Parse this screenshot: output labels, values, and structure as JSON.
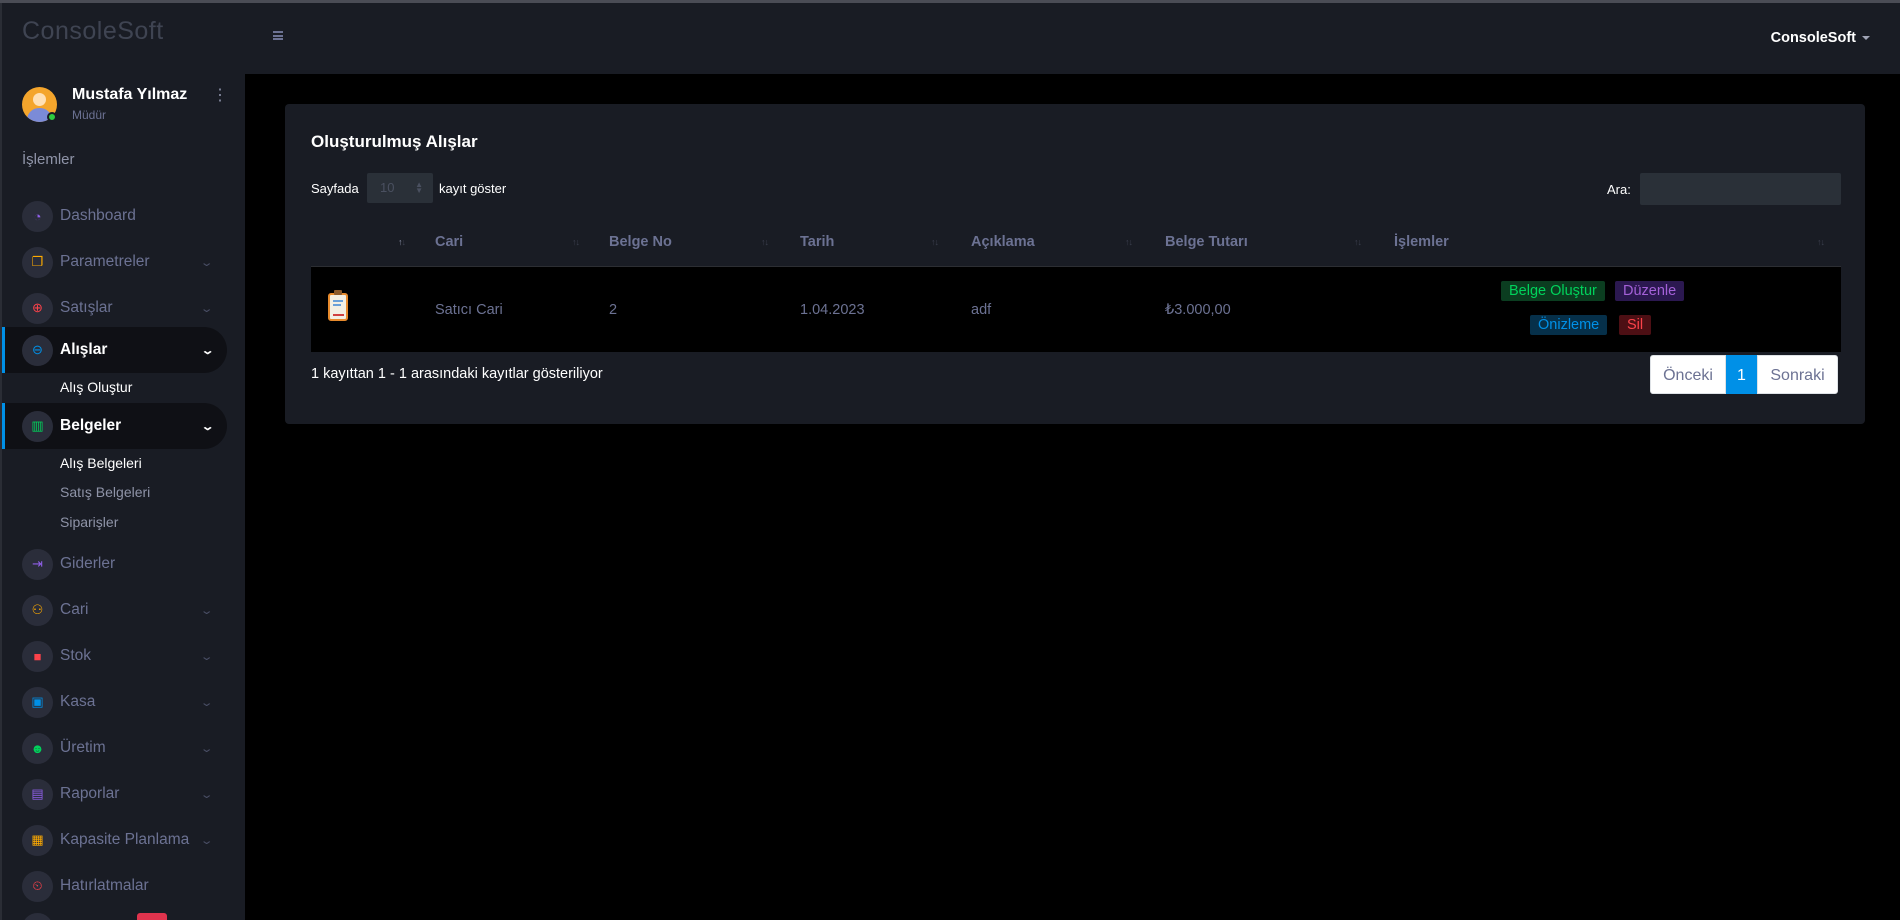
{
  "app": {
    "brand": "ConsoleSoft"
  },
  "user": {
    "name": "Mustafa Yılmaz",
    "role": "Müdür",
    "menu_label": "ConsoleSoft"
  },
  "sidebar": {
    "section": "İşlemler",
    "items": [
      {
        "label": "Dashboard",
        "icon": "speedometer-icon",
        "color": "#8f5fe8"
      },
      {
        "label": "Parametreler",
        "icon": "layers-icon",
        "color": "#ffab00"
      },
      {
        "label": "Satışlar",
        "icon": "plus-circle-icon",
        "color": "#fc424a"
      },
      {
        "label": "Alışlar",
        "icon": "minus-circle-icon",
        "color": "#0090e7"
      },
      {
        "label": "Belgeler",
        "icon": "book-icon",
        "color": "#00d25b"
      },
      {
        "label": "Giderler",
        "icon": "arrow-right-icon",
        "color": "#8f5fe8"
      },
      {
        "label": "Cari",
        "icon": "users-icon",
        "color": "#ffab00"
      },
      {
        "label": "Stok",
        "icon": "box-icon",
        "color": "#fc424a"
      },
      {
        "label": "Kasa",
        "icon": "cash-icon",
        "color": "#0090e7"
      },
      {
        "label": "Üretim",
        "icon": "robot-icon",
        "color": "#00d25b"
      },
      {
        "label": "Raporlar",
        "icon": "clipboard-icon",
        "color": "#8f5fe8"
      },
      {
        "label": "Kapasite Planlama",
        "icon": "clipboard-check-icon",
        "color": "#ffab00"
      },
      {
        "label": "Hatırlatmalar",
        "icon": "alarm-icon",
        "color": "#fc424a"
      }
    ],
    "alislar_sub": [
      "Alış Oluştur"
    ],
    "belgeler_sub": [
      "Alış Belgeleri",
      "Satış Belgeleri",
      "Siparişler"
    ]
  },
  "card": {
    "title": "Oluşturulmuş Alışlar",
    "length_prefix": "Sayfada",
    "length_value": "10",
    "length_suffix": "kayıt göster",
    "search_label": "Ara:",
    "search_value": "",
    "columns": [
      "",
      "Cari",
      "Belge No",
      "Tarih",
      "Açıklama",
      "Belge Tutarı",
      "İşlemler"
    ],
    "rows": [
      {
        "icon": "clipboard-chart-icon",
        "cari": "Satıcı Cari",
        "belge_no": "2",
        "tarih": "1.04.2023",
        "aciklama": "adf",
        "tutar": "₺3.000,00",
        "actions": {
          "create": "Belge Oluştur",
          "edit": "Düzenle",
          "preview": "Önizleme",
          "delete": "Sil"
        }
      }
    ],
    "info": "1 kayıttan 1 - 1 arasındaki kayıtlar gösteriliyor",
    "pager": {
      "prev": "Önceki",
      "current": "1",
      "next": "Sonraki"
    }
  }
}
